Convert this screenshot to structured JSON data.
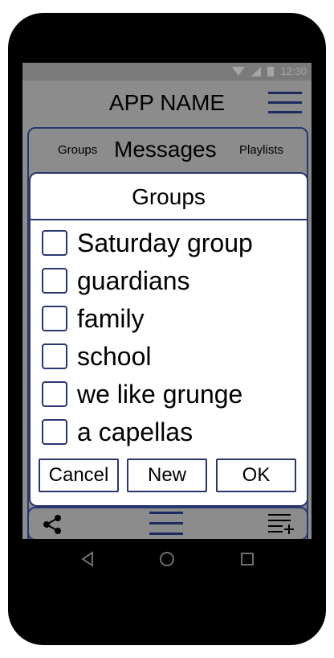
{
  "status_bar": {
    "time": "12:30"
  },
  "app_bar": {
    "title": "APP NAME"
  },
  "tabs": {
    "groups": "Groups",
    "messages": "Messages",
    "playlists": "Playlists"
  },
  "dialog": {
    "title": "Groups",
    "options": [
      {
        "label": "Saturday group",
        "checked": false
      },
      {
        "label": "guardians",
        "checked": false
      },
      {
        "label": "family",
        "checked": false
      },
      {
        "label": "school",
        "checked": false
      },
      {
        "label": "we like grunge",
        "checked": false
      },
      {
        "label": "a capellas",
        "checked": false
      }
    ],
    "buttons": {
      "cancel": "Cancel",
      "new": "New",
      "ok": "OK"
    }
  },
  "bottom_bar": {
    "icons": [
      "share-icon",
      "menu-icon",
      "playlist-add-icon"
    ]
  },
  "nav_bar": {
    "icons": [
      "back-icon",
      "home-icon",
      "recents-icon"
    ]
  },
  "colors": {
    "accent": "#2a3670",
    "dim": "#8c8c8c"
  }
}
